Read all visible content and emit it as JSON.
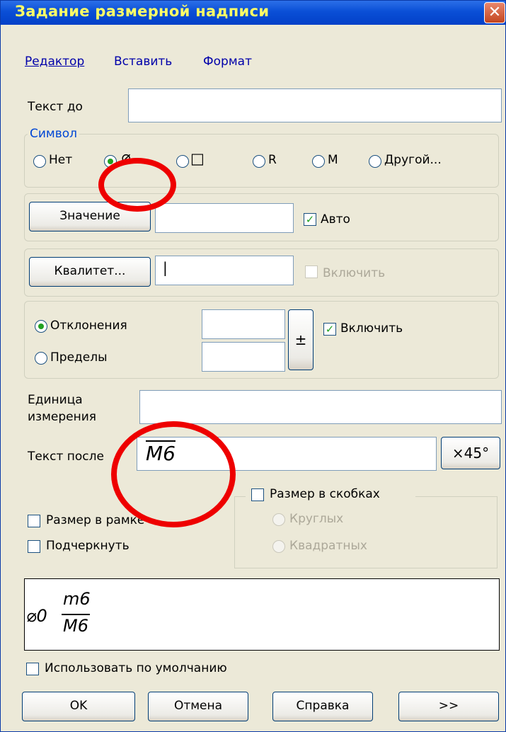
{
  "window": {
    "title": "Задание размерной надписи",
    "close_glyph": "✕"
  },
  "menu": {
    "items": [
      "Редактор",
      "Вставить",
      "Формат"
    ]
  },
  "text_before": {
    "label": "Текст до",
    "value": ""
  },
  "symbol": {
    "legend": "Символ",
    "options": [
      "Нет",
      "⌀",
      "□",
      "R",
      "M",
      "Другой..."
    ],
    "selected_index": 1
  },
  "value_row": {
    "button": "Значение",
    "value": "",
    "auto_label": "Авто",
    "auto_checked": true
  },
  "quality_row": {
    "button": "Квалитет...",
    "value": "|",
    "enable_label": "Включить",
    "enable_checked": false
  },
  "deviation": {
    "deviations_label": "Отклонения",
    "limits_label": "Пределы",
    "pm_glyph": "±",
    "enable_label": "Включить",
    "enable_checked": true
  },
  "unit": {
    "label_line1": "Единица",
    "label_line2": "измерения",
    "value": ""
  },
  "text_after": {
    "label": "Текст после",
    "value": "M6",
    "button": "×45°"
  },
  "brackets": {
    "label": "Размер в скобках",
    "round": "Круглых",
    "square": "Квадратных"
  },
  "options": {
    "frame": "Размер в рамке",
    "underline": "Подчеркнуть"
  },
  "preview": {
    "prefix": "⌀0",
    "top": "m6",
    "bottom": "M6"
  },
  "default": {
    "label": "Использовать по умолчанию"
  },
  "buttons": {
    "ok": "OK",
    "cancel": "Отмена",
    "help": "Справка",
    "more": ">>"
  },
  "colors": {
    "title_text": "#ffff66",
    "title_bar": "#0a4fd6",
    "annotation": "#ee0000"
  }
}
